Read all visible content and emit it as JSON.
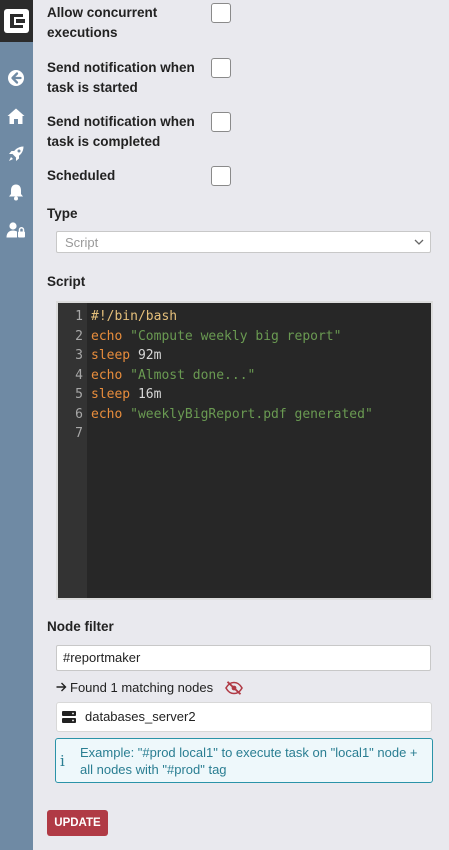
{
  "options": [
    {
      "label": "Allow concurrent executions",
      "checked": false
    },
    {
      "label": "Send notification when task is started",
      "checked": false
    },
    {
      "label": "Send notification when task is completed",
      "checked": false
    },
    {
      "label": "Scheduled",
      "checked": false
    }
  ],
  "type": {
    "label": "Type",
    "placeholder": "Script"
  },
  "script": {
    "label": "Script",
    "lines": [
      {
        "num": "1",
        "parts": [
          {
            "t": "#!/bin/bash",
            "c": "kw-comment"
          }
        ]
      },
      {
        "num": "2",
        "parts": [
          {
            "t": "echo ",
            "c": "kw"
          },
          {
            "t": "\"Compute weekly big report\"",
            "c": "str"
          }
        ]
      },
      {
        "num": "3",
        "parts": [
          {
            "t": "sleep",
            "c": "kw"
          },
          {
            "t": " 92m",
            "c": "plain"
          }
        ]
      },
      {
        "num": "4",
        "parts": [
          {
            "t": "echo ",
            "c": "kw"
          },
          {
            "t": "\"Almost done...\"",
            "c": "str"
          }
        ]
      },
      {
        "num": "5",
        "parts": [
          {
            "t": "sleep",
            "c": "kw"
          },
          {
            "t": " 16m",
            "c": "plain"
          }
        ]
      },
      {
        "num": "6",
        "parts": [
          {
            "t": "echo ",
            "c": "kw"
          },
          {
            "t": "\"weeklyBigReport.pdf generated\"",
            "c": "str"
          }
        ]
      },
      {
        "num": "7",
        "parts": []
      }
    ]
  },
  "node_filter": {
    "label": "Node filter",
    "value": "#reportmaker",
    "found_text": "Found 1 matching nodes",
    "node_name": "databases_server2",
    "info_text": "Example: \"#prod local1\" to execute task on \"local1\" node + all nodes with \"#prod\" tag"
  },
  "update_label": "UPDATE",
  "colors": {
    "sidebar": "#6f8aa4",
    "update_button": "#b03a45",
    "info_border": "#2a93a8"
  }
}
